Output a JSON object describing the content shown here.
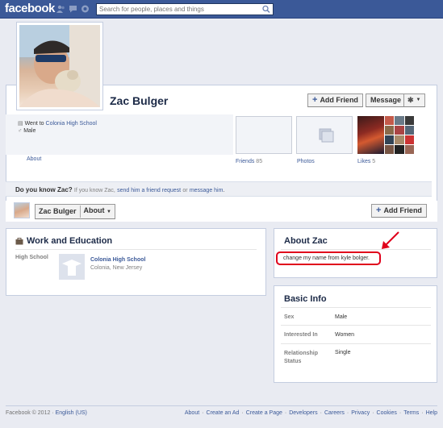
{
  "topbar": {
    "logo": "facebook",
    "search_placeholder": "Search for people, places and things"
  },
  "profile": {
    "name": "Zac Bulger",
    "add_friend_label": "Add Friend",
    "message_label": "Message",
    "went_to_prefix": "Went to",
    "school_link": "Colonia High School",
    "gender": "Male",
    "about_link": "About",
    "friends_label": "Friends",
    "friends_count": "85",
    "photos_label": "Photos",
    "likes_label": "Likes",
    "likes_count": "5"
  },
  "know_bar": {
    "question": "Do you know Zac?",
    "prefix": "If you know Zac,",
    "friend_request_link": "send him a friend request",
    "or": "or",
    "message_link": "message him",
    "period": "."
  },
  "subnav": {
    "name_tab": "Zac Bulger",
    "about_tab": "About",
    "add_friend_label": "Add Friend"
  },
  "work_education": {
    "title": "Work and Education",
    "section_label": "High School",
    "school_name": "Colonia High School",
    "school_location": "Colonia, New Jersey"
  },
  "about_zac": {
    "title": "About Zac",
    "text": "change my name from kyle bolger.",
    "annotation_color": "#e0001b"
  },
  "basic_info": {
    "title": "Basic Info",
    "rows": [
      {
        "label": "Sex",
        "value": "Male"
      },
      {
        "label": "Interested In",
        "value": "Women"
      },
      {
        "label": "Relationship Status",
        "value": "Single"
      }
    ]
  },
  "footer": {
    "copyright": "Facebook © 2012 ·",
    "language": "English (US)",
    "links": [
      "About",
      "Create an Ad",
      "Create a Page",
      "Developers",
      "Careers",
      "Privacy",
      "Cookies",
      "Terms",
      "Help"
    ]
  },
  "colors": {
    "brand_blue": "#3b5998",
    "page_bg": "#e9ebf2"
  }
}
